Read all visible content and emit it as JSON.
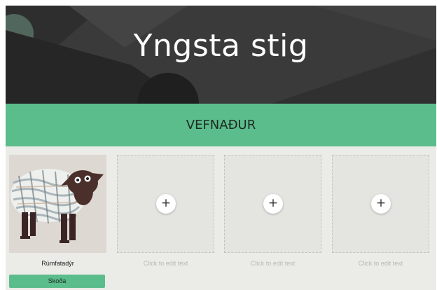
{
  "header": {
    "title": "Yngsta stig"
  },
  "section": {
    "title": "VEFNAÐUR"
  },
  "gallery": {
    "items": [
      {
        "caption": "Rúmfatadýr",
        "button_label": "Skoða",
        "image": "woven-sheep-artwork"
      },
      {
        "caption": "Click to edit text",
        "add_icon": "+"
      },
      {
        "caption": "Click to edit text",
        "add_icon": "+"
      },
      {
        "caption": "Click to edit text",
        "add_icon": "+"
      }
    ]
  },
  "colors": {
    "accent": "#5bbd8b",
    "header_bg": "#363636",
    "page_bg": "#ebebe7"
  }
}
